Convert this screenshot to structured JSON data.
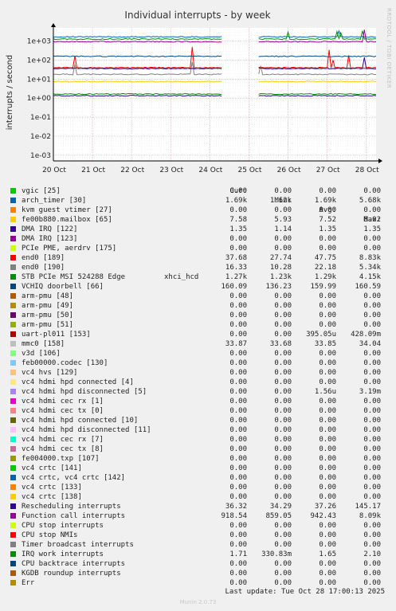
{
  "chart_data": {
    "type": "line",
    "title": "Individual interrupts - by week",
    "ylabel": "interrupts / second",
    "yscale": "log",
    "ylim": [
      0.0005,
      5000
    ],
    "yticks": [
      {
        "value": 1000,
        "label": "1e+03"
      },
      {
        "value": 100,
        "label": "1e+02"
      },
      {
        "value": 10,
        "label": "1e+01"
      },
      {
        "value": 1,
        "label": "1e+00"
      },
      {
        "value": 0.1,
        "label": "1e-01"
      },
      {
        "value": 0.01,
        "label": "1e-02"
      },
      {
        "value": 0.001,
        "label": "1e-03"
      }
    ],
    "xlim": [
      0,
      8.25
    ],
    "xticks": [
      {
        "value": 0,
        "label": "20 Oct"
      },
      {
        "value": 1,
        "label": "21 Oct"
      },
      {
        "value": 2,
        "label": "22 Oct"
      },
      {
        "value": 3,
        "label": "23 Oct"
      },
      {
        "value": 4,
        "label": "24 Oct"
      },
      {
        "value": 5,
        "label": "25 Oct"
      },
      {
        "value": 6,
        "label": "26 Oct"
      },
      {
        "value": 7,
        "label": "27 Oct"
      },
      {
        "value": 8,
        "label": "28 Oct"
      }
    ],
    "gap": [
      4.3,
      5.25
    ],
    "grid": true,
    "series": [
      {
        "name": "vgic [25]",
        "color": "#00cc00",
        "level": 0,
        "spikes": []
      },
      {
        "name": "arch_timer [30]",
        "color": "#0066b3",
        "level": 1690,
        "spikes": [
          [
            7.3,
            3500
          ]
        ]
      },
      {
        "name": "kvm guest vtimer [27]",
        "color": "#ff8000",
        "level": 0,
        "spikes": []
      },
      {
        "name": "fe00b880.mailbox [65]",
        "color": "#ffcc00",
        "level": 7.52,
        "spikes": []
      },
      {
        "name": "DMA IRQ [122]",
        "color": "#330099",
        "level": 1.35,
        "spikes": []
      },
      {
        "name": "DMA IRQ [123]",
        "color": "#990099",
        "level": 0,
        "spikes": []
      },
      {
        "name": "PCIe PME, aerdrv [175]",
        "color": "#ccff00",
        "level": 0,
        "spikes": []
      },
      {
        "name": "end0 [189]",
        "color": "#ff0000",
        "level": 40,
        "spikes": [
          [
            0.55,
            170
          ],
          [
            3.55,
            500
          ],
          [
            5.25,
            0.015
          ],
          [
            7.05,
            350
          ],
          [
            7.15,
            100
          ],
          [
            7.55,
            180
          ]
        ]
      },
      {
        "name": "end0 [190]",
        "color": "#808080",
        "level": 18,
        "spikes": [
          [
            0.55,
            60
          ],
          [
            3.55,
            80
          ],
          [
            5.3,
            50
          ]
        ]
      },
      {
        "name": "STB PCIe MSI 524288 Edge",
        "extra": "xhci_hcd",
        "color": "#008f00",
        "level": 1290,
        "spikes": [
          [
            6.0,
            3000
          ],
          [
            7.25,
            3200
          ],
          [
            7.35,
            2800
          ],
          [
            7.9,
            3500
          ]
        ]
      },
      {
        "name": "VCHIQ doorbell [66]",
        "color": "#00487d",
        "level": 160,
        "spikes": []
      },
      {
        "name": "arm-pmu [48]",
        "color": "#b35a00",
        "level": 0,
        "spikes": []
      },
      {
        "name": "arm-pmu [49]",
        "color": "#b38f00",
        "level": 0,
        "spikes": []
      },
      {
        "name": "arm-pmu [50]",
        "color": "#6b006b",
        "level": 0,
        "spikes": []
      },
      {
        "name": "arm-pmu [51]",
        "color": "#8fb300",
        "level": 0,
        "spikes": []
      },
      {
        "name": "uart-pl011 [153]",
        "color": "#b30000",
        "level": 0,
        "spikes": []
      },
      {
        "name": "mmc0 [158]",
        "color": "#bebebe",
        "level": 33.85,
        "spikes": []
      },
      {
        "name": "v3d [106]",
        "color": "#80ff80",
        "level": 0,
        "spikes": []
      },
      {
        "name": "feb00000.codec [130]",
        "color": "#80c9ff",
        "level": 0,
        "spikes": []
      },
      {
        "name": "vc4 hvs [129]",
        "color": "#ffc080",
        "level": 0,
        "spikes": []
      },
      {
        "name": "vc4 hdmi hpd connected [4]",
        "color": "#ffe680",
        "level": 0,
        "spikes": []
      },
      {
        "name": "vc4 hdmi hpd disconnected [5]",
        "color": "#aa80ff",
        "level": 0,
        "spikes": []
      },
      {
        "name": "vc4 hdmi cec rx [1]",
        "color": "#ee00cc",
        "level": 0,
        "spikes": []
      },
      {
        "name": "vc4 hdmi cec tx [0]",
        "color": "#ff8080",
        "level": 0,
        "spikes": []
      },
      {
        "name": "vc4 hdmi hpd connected [10]",
        "color": "#666600",
        "level": 0,
        "spikes": []
      },
      {
        "name": "vc4 hdmi hpd disconnected [11]",
        "color": "#ffbfff",
        "level": 0,
        "spikes": []
      },
      {
        "name": "vc4 hdmi cec rx [7]",
        "color": "#00ffcc",
        "level": 0,
        "spikes": []
      },
      {
        "name": "vc4 hdmi cec tx [8]",
        "color": "#cc6699",
        "level": 0,
        "spikes": []
      },
      {
        "name": "fe004000.txp [107]",
        "color": "#999900",
        "level": 0,
        "spikes": []
      },
      {
        "name": "vc4 crtc [141]",
        "color": "#00cc00",
        "level": 0,
        "spikes": []
      },
      {
        "name": "vc4 crtc, vc4 crtc [142]",
        "color": "#0066b3",
        "level": 0,
        "spikes": []
      },
      {
        "name": "vc4 crtc [133]",
        "color": "#ff8000",
        "level": 0,
        "spikes": []
      },
      {
        "name": "vc4 crtc [138]",
        "color": "#ffcc00",
        "level": 0,
        "spikes": []
      },
      {
        "name": "Rescheduling interrupts",
        "color": "#330099",
        "level": 37.26,
        "spikes": [
          [
            7.95,
            140
          ]
        ]
      },
      {
        "name": "Function call interrupts",
        "color": "#990099",
        "level": 942,
        "spikes": [
          [
            7.95,
            4000
          ]
        ]
      },
      {
        "name": "CPU stop interrupts",
        "color": "#ccff00",
        "level": 0,
        "spikes": []
      },
      {
        "name": "CPU stop NMIs",
        "color": "#ff0000",
        "level": 0,
        "spikes": []
      },
      {
        "name": "Timer broadcast interrupts",
        "color": "#808080",
        "level": 0,
        "spikes": []
      },
      {
        "name": "IRQ work interrupts",
        "color": "#008f00",
        "level": 1.65,
        "spikes": []
      },
      {
        "name": "CPU backtrace interrupts",
        "color": "#00487d",
        "level": 0,
        "spikes": []
      },
      {
        "name": "KGDB roundup interrupts",
        "color": "#b35a00",
        "level": 0,
        "spikes": []
      },
      {
        "name": "Err",
        "color": "#b38f00",
        "level": 0,
        "spikes": []
      }
    ]
  },
  "legend": {
    "headers": {
      "cur": "Cur:",
      "min": "Min:",
      "avg": "Avg:",
      "max": "Max:"
    },
    "rows": [
      {
        "cur": "0.00",
        "min": "0.00",
        "avg": "0.00",
        "max": "0.00"
      },
      {
        "cur": "1.69k",
        "min": "1.62k",
        "avg": "1.69k",
        "max": "5.68k"
      },
      {
        "cur": "0.00",
        "min": "0.00",
        "avg": "0.00",
        "max": "0.00"
      },
      {
        "cur": "7.58",
        "min": "5.93",
        "avg": "7.52",
        "max": "8.02"
      },
      {
        "cur": "1.35",
        "min": "1.14",
        "avg": "1.35",
        "max": "1.35"
      },
      {
        "cur": "0.00",
        "min": "0.00",
        "avg": "0.00",
        "max": "0.00"
      },
      {
        "cur": "0.00",
        "min": "0.00",
        "avg": "0.00",
        "max": "0.00"
      },
      {
        "cur": "37.68",
        "min": "27.74",
        "avg": "47.75",
        "max": "8.83k"
      },
      {
        "cur": "16.33",
        "min": "10.28",
        "avg": "22.18",
        "max": "5.34k"
      },
      {
        "cur": "1.27k",
        "min": "1.23k",
        "avg": "1.29k",
        "max": "4.15k"
      },
      {
        "cur": "160.09",
        "min": "136.23",
        "avg": "159.99",
        "max": "160.59"
      },
      {
        "cur": "0.00",
        "min": "0.00",
        "avg": "0.00",
        "max": "0.00"
      },
      {
        "cur": "0.00",
        "min": "0.00",
        "avg": "0.00",
        "max": "0.00"
      },
      {
        "cur": "0.00",
        "min": "0.00",
        "avg": "0.00",
        "max": "0.00"
      },
      {
        "cur": "0.00",
        "min": "0.00",
        "avg": "0.00",
        "max": "0.00"
      },
      {
        "cur": "0.00",
        "min": "0.00",
        "avg": "395.05u",
        "max": "428.09m"
      },
      {
        "cur": "33.87",
        "min": "33.68",
        "avg": "33.85",
        "max": "34.04"
      },
      {
        "cur": "0.00",
        "min": "0.00",
        "avg": "0.00",
        "max": "0.00"
      },
      {
        "cur": "0.00",
        "min": "0.00",
        "avg": "0.00",
        "max": "0.00"
      },
      {
        "cur": "0.00",
        "min": "0.00",
        "avg": "0.00",
        "max": "0.00"
      },
      {
        "cur": "0.00",
        "min": "0.00",
        "avg": "0.00",
        "max": "0.00"
      },
      {
        "cur": "0.00",
        "min": "0.00",
        "avg": "1.56u",
        "max": "3.19m"
      },
      {
        "cur": "0.00",
        "min": "0.00",
        "avg": "0.00",
        "max": "0.00"
      },
      {
        "cur": "0.00",
        "min": "0.00",
        "avg": "0.00",
        "max": "0.00"
      },
      {
        "cur": "0.00",
        "min": "0.00",
        "avg": "0.00",
        "max": "0.00"
      },
      {
        "cur": "0.00",
        "min": "0.00",
        "avg": "0.00",
        "max": "0.00"
      },
      {
        "cur": "0.00",
        "min": "0.00",
        "avg": "0.00",
        "max": "0.00"
      },
      {
        "cur": "0.00",
        "min": "0.00",
        "avg": "0.00",
        "max": "0.00"
      },
      {
        "cur": "0.00",
        "min": "0.00",
        "avg": "0.00",
        "max": "0.00"
      },
      {
        "cur": "0.00",
        "min": "0.00",
        "avg": "0.00",
        "max": "0.00"
      },
      {
        "cur": "0.00",
        "min": "0.00",
        "avg": "0.00",
        "max": "0.00"
      },
      {
        "cur": "0.00",
        "min": "0.00",
        "avg": "0.00",
        "max": "0.00"
      },
      {
        "cur": "0.00",
        "min": "0.00",
        "avg": "0.00",
        "max": "0.00"
      },
      {
        "cur": "36.32",
        "min": "34.29",
        "avg": "37.26",
        "max": "145.17"
      },
      {
        "cur": "918.54",
        "min": "859.05",
        "avg": "942.43",
        "max": "8.09k"
      },
      {
        "cur": "0.00",
        "min": "0.00",
        "avg": "0.00",
        "max": "0.00"
      },
      {
        "cur": "0.00",
        "min": "0.00",
        "avg": "0.00",
        "max": "0.00"
      },
      {
        "cur": "0.00",
        "min": "0.00",
        "avg": "0.00",
        "max": "0.00"
      },
      {
        "cur": "1.71",
        "min": "330.83m",
        "avg": "1.65",
        "max": "2.10"
      },
      {
        "cur": "0.00",
        "min": "0.00",
        "avg": "0.00",
        "max": "0.00"
      },
      {
        "cur": "0.00",
        "min": "0.00",
        "avg": "0.00",
        "max": "0.00"
      },
      {
        "cur": "0.00",
        "min": "0.00",
        "avg": "0.00",
        "max": "0.00"
      }
    ]
  },
  "footer": {
    "last_update": "Last update: Tue Oct 28 17:00:13 2025"
  },
  "branding": {
    "watermark": "RRDTOOL / TOBI OETIKER",
    "munin_version": "Munin 2.0.73"
  },
  "colors": {
    "background": "#f0f0f0",
    "plot_bg": "#ffffff",
    "grid_major": "#e6b3b3",
    "grid_minor": "#ededed"
  }
}
